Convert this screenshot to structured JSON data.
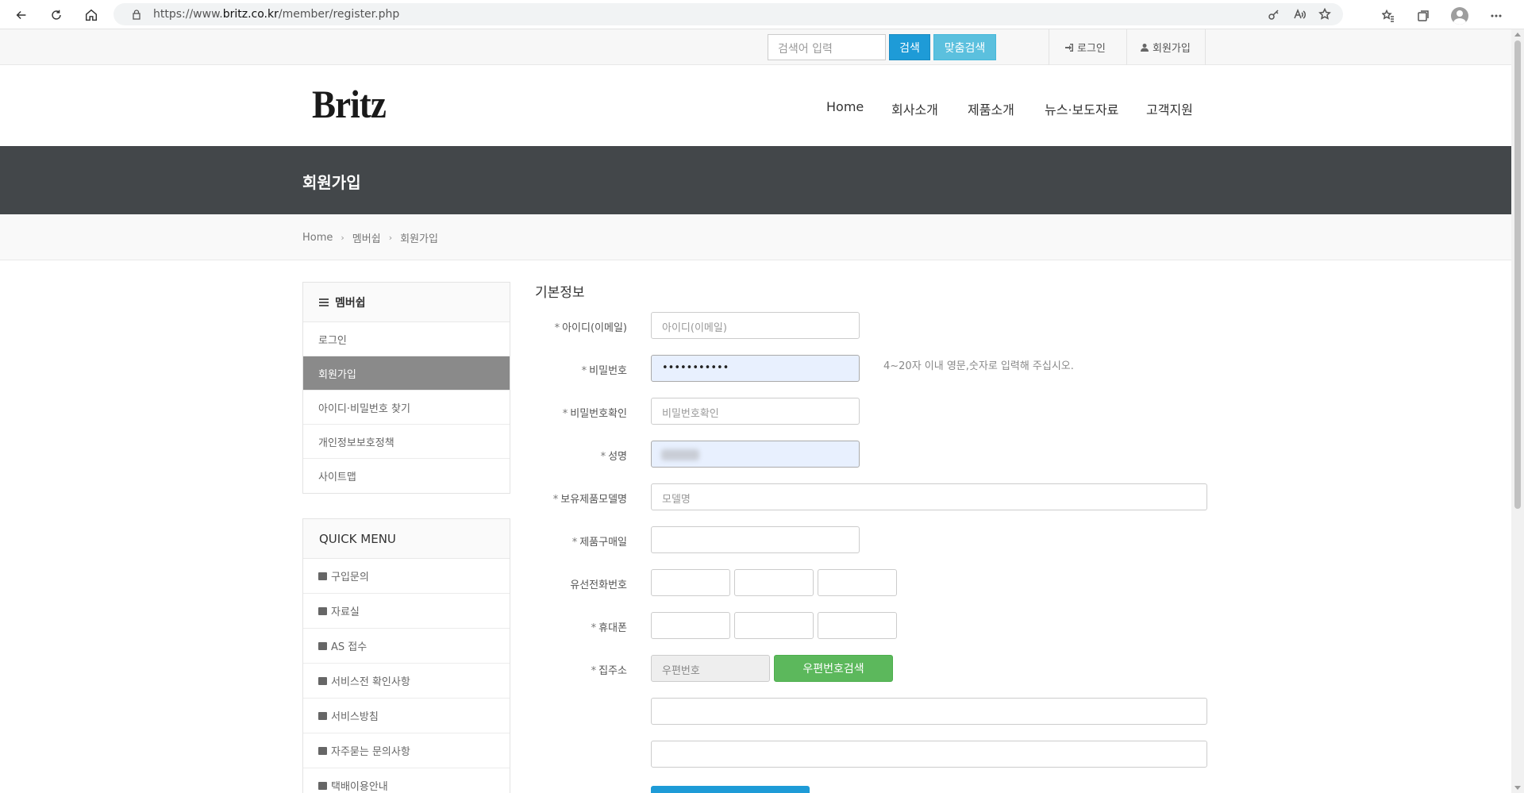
{
  "browser": {
    "url_prefix": "https://www.",
    "url_domain": "britz.co.kr",
    "url_path": "/member/register.php"
  },
  "topbar": {
    "search_placeholder": "검색어 입력",
    "search_button": "검색",
    "custom_search_button": "맞춤검색",
    "login_link": "로그인",
    "signup_link": "회원가입"
  },
  "header": {
    "logo": "Britz",
    "nav": [
      "Home",
      "회사소개",
      "제품소개",
      "뉴스·보도자료",
      "고객지원"
    ]
  },
  "page": {
    "title": "회원가입",
    "breadcrumb": [
      "Home",
      "멤버쉽",
      "회원가입"
    ]
  },
  "sidebar": {
    "heading": "멤버쉽",
    "items": [
      "로그인",
      "회원가입",
      "아이디·비밀번호 찾기",
      "개인정보보호정책",
      "사이트맵"
    ],
    "active_index": 1
  },
  "quick_menu": {
    "heading": "QUICK MENU",
    "items": [
      "구입문의",
      "자료실",
      "AS 접수",
      "서비스전 확인사항",
      "서비스방침",
      "자주묻는 문의사항",
      "택배이용안내"
    ]
  },
  "form": {
    "section_title": "기본정보",
    "labels": {
      "id": "아이디(이메일)",
      "password": "비밀번호",
      "password_confirm": "비밀번호확인",
      "name": "성명",
      "model": "보유제품모델명",
      "purchase": "제품구매일",
      "phone": "유선전화번호",
      "mobile": "휴대폰",
      "address": "집주소"
    },
    "required_marker": "*",
    "placeholders": {
      "id": "아이디(이메일)",
      "password_confirm": "비밀번호확인",
      "model": "모델명",
      "zipcode": "우편번호"
    },
    "password_value": "•••••••••••",
    "password_help": "4~20자 이내 영문,숫자로 입력해 주십시오.",
    "zip_button": "우편번호검색"
  }
}
